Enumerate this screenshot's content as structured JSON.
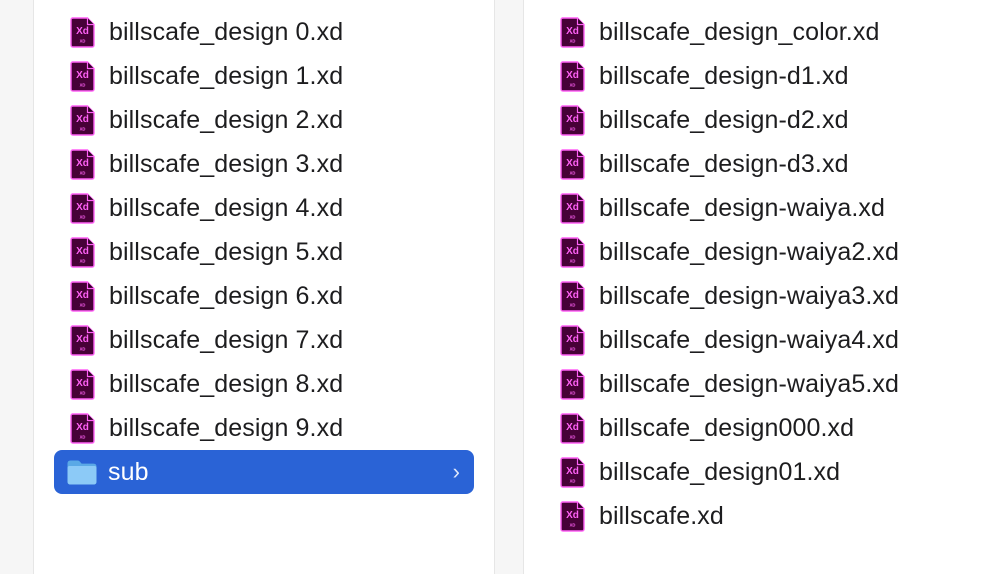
{
  "left_column": {
    "files": [
      {
        "name": "billscafe_design 0.xd",
        "icon": "xd-file-icon"
      },
      {
        "name": "billscafe_design 1.xd",
        "icon": "xd-file-icon"
      },
      {
        "name": "billscafe_design 2.xd",
        "icon": "xd-file-icon"
      },
      {
        "name": "billscafe_design 3.xd",
        "icon": "xd-file-icon"
      },
      {
        "name": "billscafe_design 4.xd",
        "icon": "xd-file-icon"
      },
      {
        "name": "billscafe_design 5.xd",
        "icon": "xd-file-icon"
      },
      {
        "name": "billscafe_design 6.xd",
        "icon": "xd-file-icon"
      },
      {
        "name": "billscafe_design 7.xd",
        "icon": "xd-file-icon"
      },
      {
        "name": "billscafe_design 8.xd",
        "icon": "xd-file-icon"
      },
      {
        "name": "billscafe_design 9.xd",
        "icon": "xd-file-icon"
      }
    ],
    "folder": {
      "name": "sub",
      "icon": "folder-icon",
      "selected": true,
      "chevron": "›"
    }
  },
  "right_column": {
    "files": [
      {
        "name": "billscafe_design_color.xd",
        "icon": "xd-file-icon"
      },
      {
        "name": "billscafe_design-d1.xd",
        "icon": "xd-file-icon"
      },
      {
        "name": "billscafe_design-d2.xd",
        "icon": "xd-file-icon"
      },
      {
        "name": "billscafe_design-d3.xd",
        "icon": "xd-file-icon"
      },
      {
        "name": "billscafe_design-waiya.xd",
        "icon": "xd-file-icon"
      },
      {
        "name": "billscafe_design-waiya2.xd",
        "icon": "xd-file-icon"
      },
      {
        "name": "billscafe_design-waiya3.xd",
        "icon": "xd-file-icon"
      },
      {
        "name": "billscafe_design-waiya4.xd",
        "icon": "xd-file-icon"
      },
      {
        "name": "billscafe_design-waiya5.xd",
        "icon": "xd-file-icon"
      },
      {
        "name": "billscafe_design000.xd",
        "icon": "xd-file-icon"
      },
      {
        "name": "billscafe_design01.xd",
        "icon": "xd-file-icon"
      },
      {
        "name": "billscafe.xd",
        "icon": "xd-file-icon"
      }
    ]
  },
  "icon_text": {
    "xd": "Xd",
    "xd_small": "XD"
  },
  "colors": {
    "selection": "#2a63d6",
    "xd_icon_bg": "#470137",
    "xd_icon_accent": "#ff61f6",
    "folder": "#7ec3f4"
  }
}
